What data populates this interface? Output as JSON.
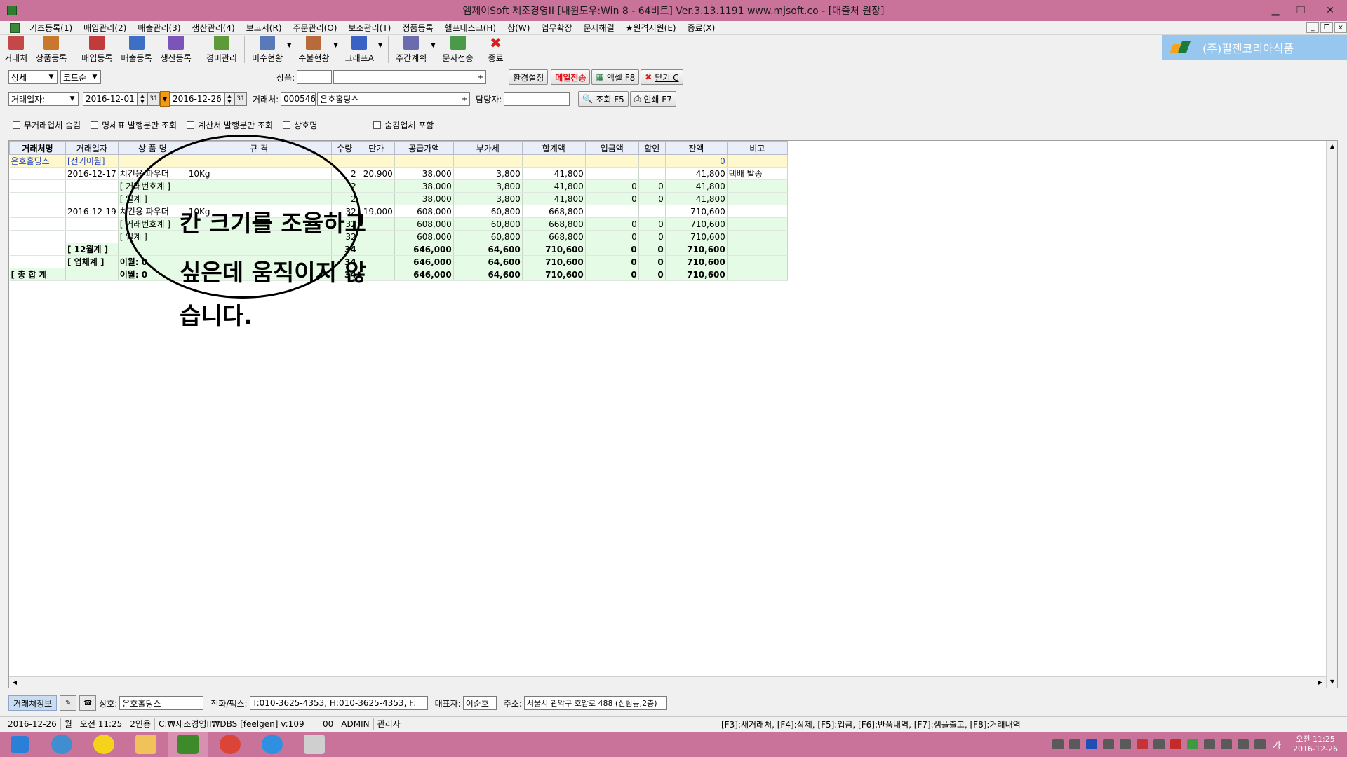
{
  "window": {
    "title": "엠제이Soft 제조경영II [내윈도우:Win 8 - 64비트] Ver.3.13.1191          www.mjsoft.co - [매출처 원장]"
  },
  "menu": [
    "기초등록(1)",
    "매입관리(2)",
    "매출관리(3)",
    "생산관리(4)",
    "보고서(R)",
    "주문관리(O)",
    "보조관리(T)",
    "정품등록",
    "헬프데스크(H)",
    "창(W)",
    "업무확장",
    "문제해결",
    "★원격지원(E)",
    "종료(X)"
  ],
  "toolbar": [
    {
      "label": "거래처",
      "icon": "client-icon",
      "color": "#c44848"
    },
    {
      "label": "상품등록",
      "icon": "product-icon",
      "color": "#c9772d"
    },
    {
      "label": "매입등록",
      "icon": "purchase-icon",
      "color": "#c23b3b"
    },
    {
      "label": "매출등록",
      "icon": "sales-icon",
      "color": "#3d6fc4"
    },
    {
      "label": "생산등록",
      "icon": "production-icon",
      "color": "#7a54b8"
    },
    {
      "label": "경비관리",
      "icon": "expense-icon",
      "color": "#5c9a3a"
    },
    {
      "label": "미수현황",
      "icon": "receivable-icon",
      "color": "#5a79b8"
    },
    {
      "label": "수불현황",
      "icon": "inventory-icon",
      "color": "#b86a3a"
    },
    {
      "label": "그래프A",
      "icon": "graph-icon",
      "color": "#3a62c4"
    },
    {
      "label": "주간계획",
      "icon": "calendar-icon",
      "color": "#6b6bb0"
    },
    {
      "label": "문자전송",
      "icon": "sms-icon",
      "color": "#4a9a4a"
    },
    {
      "label": "종료",
      "icon": "close-icon",
      "color": "#d6201c"
    }
  ],
  "brand": "(주)필젠코리아식품",
  "filter1": {
    "view_select": "상세",
    "sort_select": "코드순",
    "product_label": "상품:",
    "product_code": "",
    "product_name": "",
    "env_btn": "환경설정",
    "mail_btn": "메일전송",
    "excel_btn": "엑셀 F8",
    "close_btn": "닫기 C"
  },
  "filter2": {
    "date_select": "거래일자:",
    "date_from": "2016-12-01",
    "date_to": "2016-12-26",
    "client_label": "거래처:",
    "client_code": "000546",
    "client_name": "은호홀딩스",
    "manager_label": "담당자:",
    "manager_value": "",
    "search_btn": "조회 F5",
    "print_btn": "인쇄 F7"
  },
  "checks": [
    "무거래업체 숨김",
    "명세표 발행분만 조회",
    "계산서 발행분만 조회",
    "상호명",
    "숨김업체 포함"
  ],
  "grid": {
    "columns": [
      "거래처명",
      "거래일자",
      "상 품 명",
      "규 격",
      "수량",
      "단가",
      "공급가액",
      "부가세",
      "합계액",
      "입금액",
      "할인",
      "잔액",
      "비고"
    ],
    "rows": [
      {
        "type": "prev",
        "cells": [
          "은호홀딩스",
          "[전기이월]",
          "",
          "",
          "",
          "",
          "",
          "",
          "",
          "",
          "",
          "0",
          ""
        ]
      },
      {
        "type": "detail",
        "cells": [
          "",
          "2016-12-17",
          "치킨용 파우더",
          "10Kg",
          "2",
          "20,900",
          "38,000",
          "3,800",
          "41,800",
          "",
          "",
          "41,800",
          "택배 발송"
        ]
      },
      {
        "type": "sub",
        "cells": [
          "",
          "",
          "[ 거래번호계 ]",
          "",
          "2",
          "",
          "38,000",
          "3,800",
          "41,800",
          "0",
          "0",
          "41,800",
          ""
        ]
      },
      {
        "type": "sub",
        "cells": [
          "",
          "",
          "[ 일계 ]",
          "",
          "2",
          "",
          "38,000",
          "3,800",
          "41,800",
          "0",
          "0",
          "41,800",
          ""
        ]
      },
      {
        "type": "detail",
        "cells": [
          "",
          "2016-12-19",
          "치킨용 파우더",
          "10Kg",
          "32",
          "19,000",
          "608,000",
          "60,800",
          "668,800",
          "",
          "",
          "710,600",
          ""
        ]
      },
      {
        "type": "sub",
        "cells": [
          "",
          "",
          "[ 거래번호계 ]",
          "",
          "32",
          "",
          "608,000",
          "60,800",
          "668,800",
          "0",
          "0",
          "710,600",
          ""
        ]
      },
      {
        "type": "sub",
        "cells": [
          "",
          "",
          "[ 일계 ]",
          "",
          "32",
          "",
          "608,000",
          "60,800",
          "668,800",
          "0",
          "0",
          "710,600",
          ""
        ]
      },
      {
        "type": "tot",
        "cells": [
          "",
          "[ 12월계 ]",
          "",
          "",
          "34",
          "",
          "646,000",
          "64,600",
          "710,600",
          "0",
          "0",
          "710,600",
          ""
        ]
      },
      {
        "type": "tot",
        "cells": [
          "",
          "[ 업체계 ]",
          "이월: 0",
          "",
          "34",
          "",
          "646,000",
          "64,600",
          "710,600",
          "0",
          "0",
          "710,600",
          ""
        ]
      },
      {
        "type": "tot",
        "cells": [
          "[ 총 합 계",
          "",
          "이월: 0",
          "",
          "34",
          "",
          "646,000",
          "64,600",
          "710,600",
          "0",
          "0",
          "710,600",
          ""
        ]
      }
    ]
  },
  "annotation": {
    "line1": "칸 크기를 조율하고",
    "line2": "싶은데 움직이지 않",
    "line3": "습니다."
  },
  "info": {
    "tab": "거래처정보",
    "name_label": "상호:",
    "name_value": "은호홀딩스",
    "phone_label": "전화/팩스:",
    "phone_value": "T:010-3625-4353, H:010-3625-4353, F:",
    "rep_label": "대표자:",
    "rep_value": "이순호",
    "addr_label": "주소:",
    "addr_value": "서울시 관악구 호암로 488 (신림동,2층)"
  },
  "status": {
    "date": "2016-12-26",
    "weekday": "월",
    "time": "오전 11:25",
    "users": "2인용",
    "path": "C:₩제조경영II₩DBS [feelgen]  v:109",
    "code": "00",
    "user": "ADMIN",
    "role": "관리자",
    "hotkeys": "[F3]:새거래처, [F4]:삭제, [F5]:입금, [F6]:반품내역, [F7]:샘플출고, [F8]:거래내역"
  },
  "taskbar": {
    "apps": [
      {
        "icon": "windows-start-icon",
        "color": "#2a7fd6"
      },
      {
        "icon": "chrome-like-icon",
        "color": "#3e8ed0"
      },
      {
        "icon": "kakaotalk-icon",
        "color": "#f6d31b"
      },
      {
        "icon": "folder-icon",
        "color": "#f1c25a"
      },
      {
        "icon": "mjsoft-icon",
        "color": "#3d8a2a"
      },
      {
        "icon": "chrome-icon",
        "color": "#db4437"
      },
      {
        "icon": "ie-icon",
        "color": "#2f8fe0"
      },
      {
        "icon": "printer-icon",
        "color": "#cfcfcf"
      }
    ],
    "lang": "가",
    "clock_time": "오전 11:25",
    "clock_date": "2016-12-26"
  }
}
